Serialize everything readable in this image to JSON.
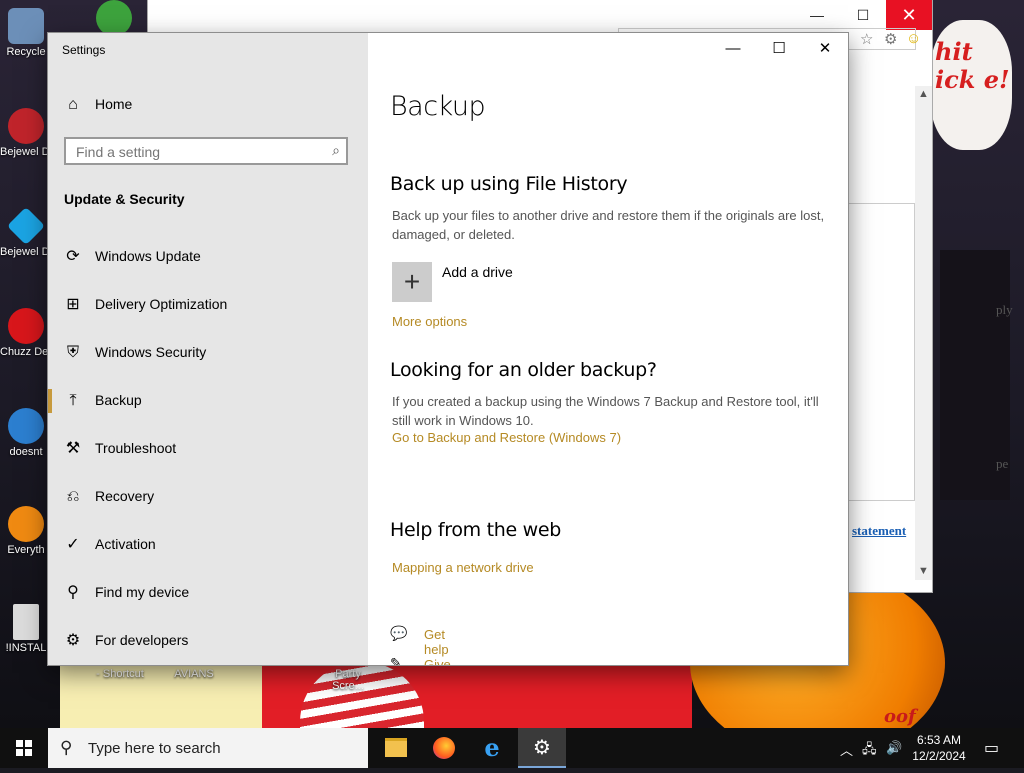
{
  "desktop": {
    "icons": [
      {
        "label": "Recycle",
        "color": "#6c8fb8"
      },
      {
        "label": "Bejewel Delux",
        "color": "#c0242b"
      },
      {
        "label": "Bejewel Delux",
        "color": "#1ba4e3"
      },
      {
        "label": "Chuzz Delux",
        "color": "#d8161b"
      },
      {
        "label": "doesnt",
        "color": "#2c7fd0"
      },
      {
        "label": "Everyth",
        "color": "#f08a12"
      },
      {
        "label": "!INSTAL",
        "color": "#dcdcdc"
      }
    ],
    "bottom_labels": [
      "- Shortcut",
      "AVIANS",
      "Party Scre..."
    ],
    "wallpaper_text": "hit ick e!",
    "wallpaper_small_text": "oof"
  },
  "browser": {
    "peek_text_1": "ply",
    "peek_text_2": "pe",
    "peek_link": "statement"
  },
  "settings": {
    "window_title": "Settings",
    "controls": {
      "minimize": "—",
      "maximize": "☐",
      "close": "✕"
    },
    "nav": {
      "home": "Home",
      "search_placeholder": "Find a setting",
      "section": "Update & Security",
      "items": [
        {
          "label": "Windows Update",
          "icon": "refresh-icon",
          "glyph": "⟳"
        },
        {
          "label": "Delivery Optimization",
          "icon": "delivery-optimization-icon",
          "glyph": "⊞"
        },
        {
          "label": "Windows Security",
          "icon": "shield-icon",
          "glyph": "⛨"
        },
        {
          "label": "Backup",
          "icon": "backup-arrow-icon",
          "glyph": "⤒"
        },
        {
          "label": "Troubleshoot",
          "icon": "wrench-icon",
          "glyph": "⚒"
        },
        {
          "label": "Recovery",
          "icon": "recovery-icon",
          "glyph": "⎌"
        },
        {
          "label": "Activation",
          "icon": "activation-check-icon",
          "glyph": "✓"
        },
        {
          "label": "Find my device",
          "icon": "person-locate-icon",
          "glyph": "⚲"
        },
        {
          "label": "For developers",
          "icon": "developer-icon",
          "glyph": "⚙"
        }
      ],
      "active_index": 3
    },
    "main": {
      "title": "Backup",
      "file_history": {
        "heading": "Back up using File History",
        "description": "Back up your files to another drive and restore them if the originals are lost, damaged, or deleted.",
        "add_drive": "Add a drive",
        "more_options": "More options"
      },
      "older_backup": {
        "heading": "Looking for an older backup?",
        "description": "If you created a backup using the Windows 7 Backup and Restore tool, it'll still work in Windows 10.",
        "link": "Go to Backup and Restore (Windows 7)"
      },
      "help_web": {
        "heading": "Help from the web",
        "link": "Mapping a network drive"
      },
      "get_help": "Get help",
      "give_feedback": "Give feedback"
    },
    "accent_color": "#b58a24"
  },
  "taskbar": {
    "search_placeholder": "Type here to search",
    "time": "6:53 AM",
    "date": "12/2/2024"
  }
}
